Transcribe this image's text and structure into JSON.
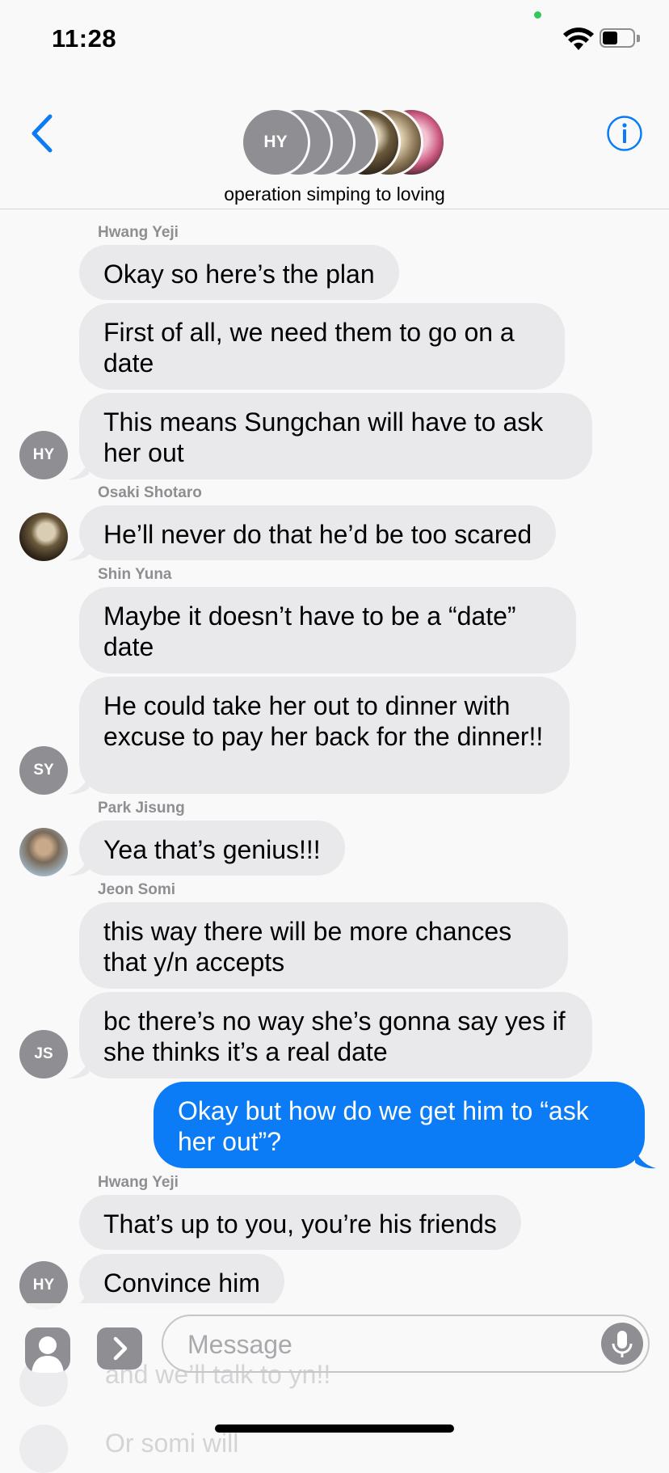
{
  "status": {
    "time": "11:28"
  },
  "header": {
    "group_name": "operation simping to loving",
    "front_avatar_initials": "HY"
  },
  "messages": [
    {
      "sender": "Hwang Yeji",
      "texts": [
        "Okay so here’s the plan",
        "First of all, we need them to go on a date",
        "This means Sungchan will have to ask her out"
      ],
      "avatar": "HY"
    },
    {
      "sender": "Osaki Shotaro",
      "texts": [
        "He’ll never do that he’d be too scared"
      ],
      "avatar": ""
    },
    {
      "sender": "Shin Yuna",
      "texts": [
        "Maybe it doesn’t have to be a “date” date",
        "He could take her out to dinner with excuse to pay her back for the dinner!!"
      ],
      "avatar": "SY"
    },
    {
      "sender": "Park Jisung",
      "texts": [
        "Yea that’s genius!!!"
      ],
      "avatar": ""
    },
    {
      "sender": "Jeon Somi",
      "texts": [
        "this way there will be more chances that y/n accepts",
        "bc there’s no way she’s gonna say yes if she thinks it’s a real date"
      ],
      "avatar": "JS"
    },
    {
      "sender": "",
      "texts": [
        "Okay but how do we get him to “ask her out”?"
      ],
      "avatar": ""
    },
    {
      "sender": "Hwang Yeji",
      "texts": [
        "That’s up to you, you’re his friends",
        "Convince him"
      ],
      "avatar": "HY"
    }
  ],
  "behind_bar": {
    "text1": "and we’ll talk to yn!!",
    "text2": "Or somi will"
  },
  "compose": {
    "placeholder": "Message"
  },
  "colors": {
    "sent_bubble": "#0b7cf5",
    "received_bubble": "#e9e9eb",
    "accent": "#0b7cf5"
  }
}
